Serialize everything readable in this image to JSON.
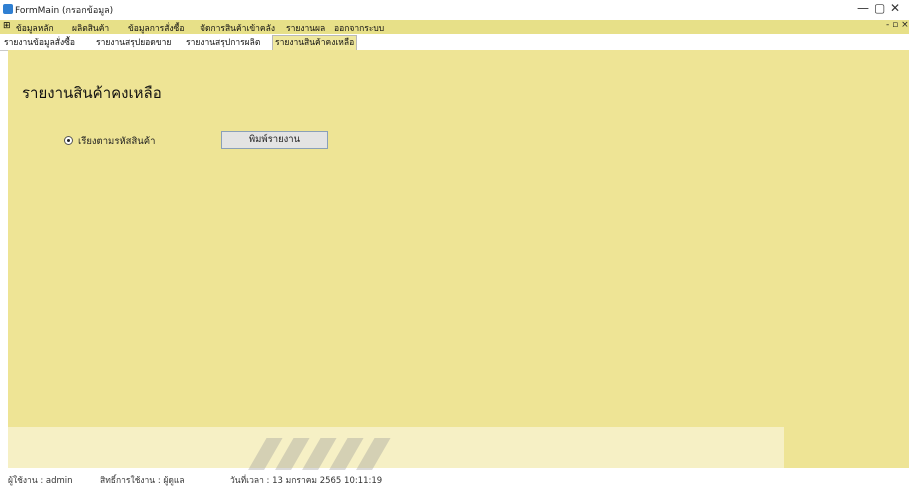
{
  "window": {
    "title": "FormMain (กรอกข้อมูล)",
    "controls": {
      "minimize": "—",
      "maximize": "▢",
      "close": "✕"
    }
  },
  "menu": {
    "items": [
      "ข้อมูลหลัก",
      "ผลิตสินค้า",
      "ข้อมูลการสั่งซื้อ",
      "จัดการสินค้าเข้าคลัง",
      "รายงานผล",
      "ออกจากระบบ"
    ],
    "child_controls": "- ▫ ×"
  },
  "tabs": {
    "items": [
      "รายงานข้อมูลสั่งซื้อ",
      "รายงานสรุปยอดขาย",
      "รายงานสรุปการผลิต",
      "รายงานสินค้าคงเหลือ"
    ],
    "active_index": 3
  },
  "main": {
    "page_title": "รายงานสินค้าคงเหลือ",
    "radio_label": "เรียงตามรหัสสินค้า",
    "radio_checked": true,
    "print_button": "พิมพ์รายงาน"
  },
  "status": {
    "items": [
      "ผู้ใช้งาน : admin",
      "สิทธิ์การใช้งาน : ผู้ดูแล",
      "วันที่เวลา : 13 มกราคม 2565 10:11:19"
    ]
  }
}
